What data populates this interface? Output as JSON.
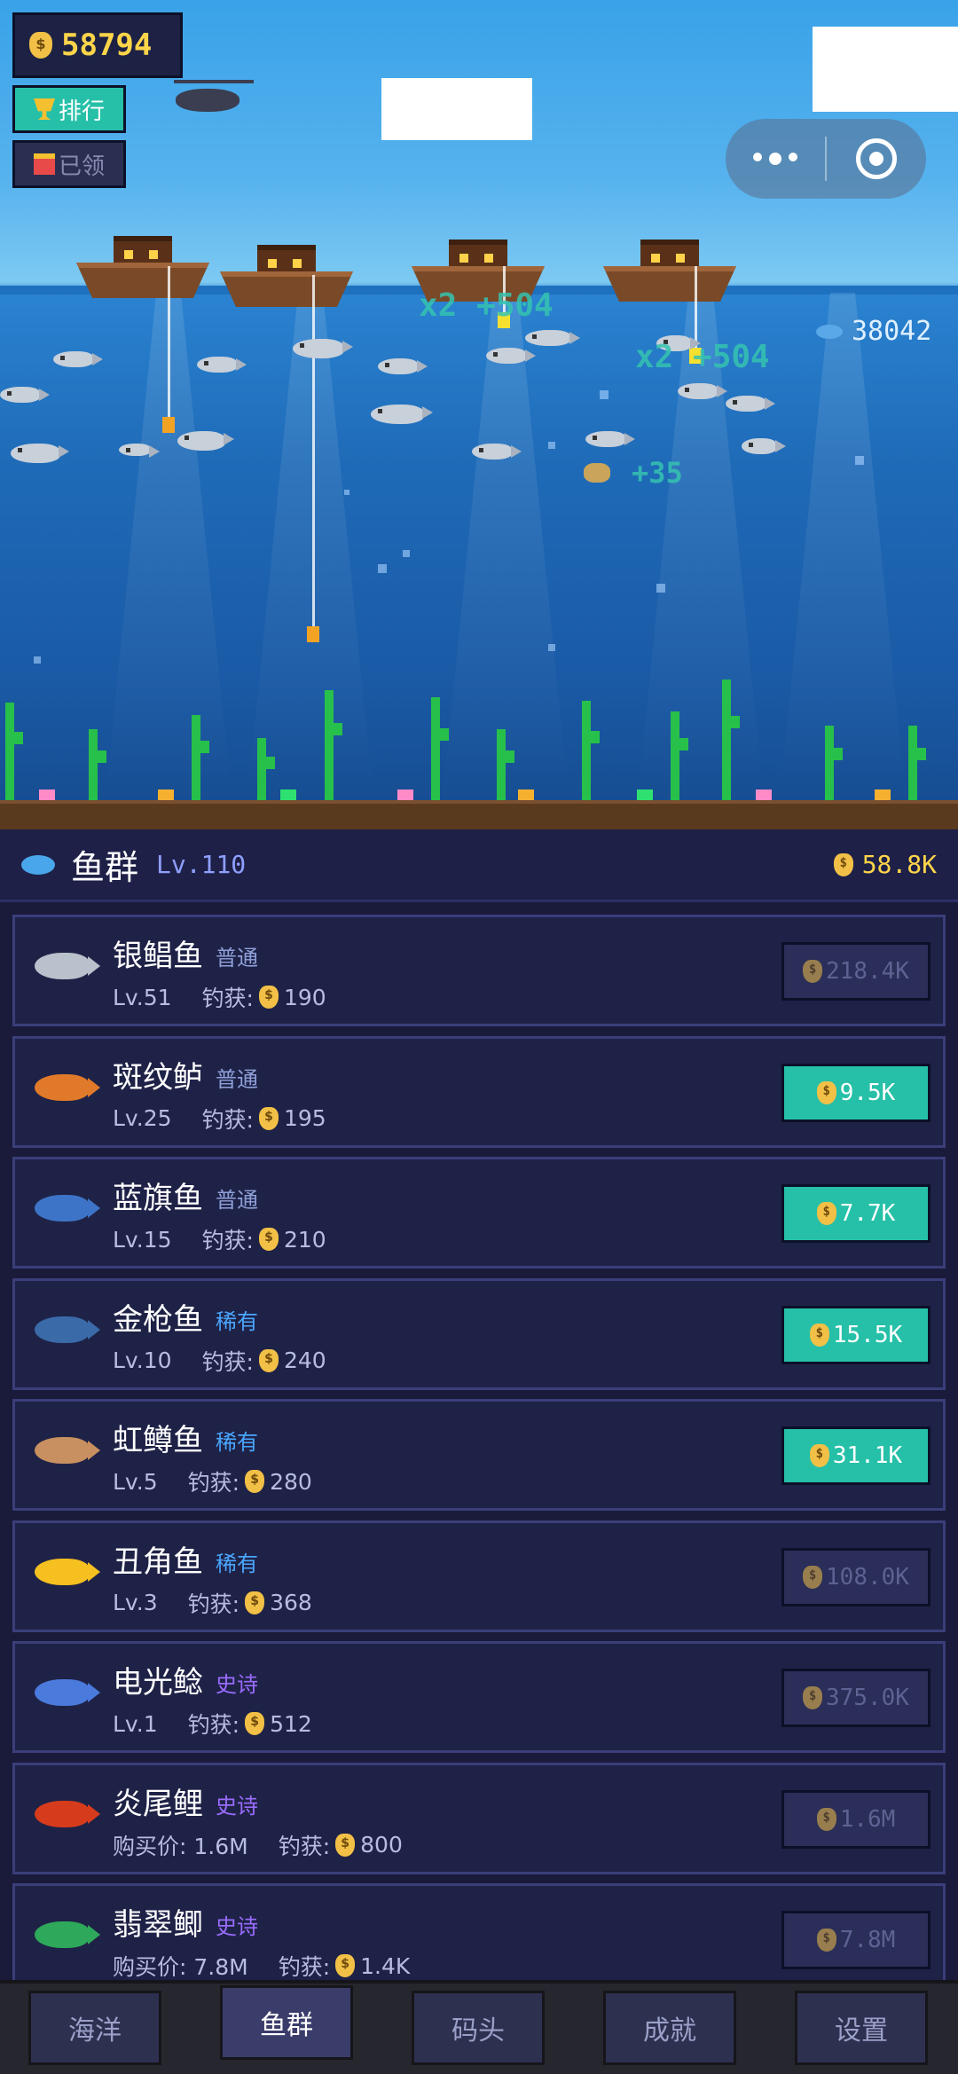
{
  "hud": {
    "money": "58794",
    "rank_label": "排行",
    "gift_label": "已领",
    "fish_count": "38042"
  },
  "scene": {
    "float_texts": [
      "x2 +504",
      "x2 +504",
      "+35"
    ]
  },
  "panel": {
    "title": "鱼群",
    "level": "Lv.110",
    "total": "58.8K"
  },
  "rows": [
    {
      "name": "银鲳鱼",
      "tag": "普通",
      "tag_color": "#8fa0d8",
      "line1": "Lv.51",
      "catch_label": "钓获:",
      "catch_value": "190",
      "price": "218.4K",
      "enabled": false,
      "color": "#b9c2cc"
    },
    {
      "name": "斑纹鲈",
      "tag": "普通",
      "tag_color": "#8fa0d8",
      "line1": "Lv.25",
      "catch_label": "钓获:",
      "catch_value": "195",
      "price": "9.5K",
      "enabled": true,
      "color": "#e07a2a"
    },
    {
      "name": "蓝旗鱼",
      "tag": "普通",
      "tag_color": "#8fa0d8",
      "line1": "Lv.15",
      "catch_label": "钓获:",
      "catch_value": "210",
      "price": "7.7K",
      "enabled": true,
      "color": "#3d74c8"
    },
    {
      "name": "金枪鱼",
      "tag": "稀有",
      "tag_color": "#4aa6ff",
      "line1": "Lv.10",
      "catch_label": "钓获:",
      "catch_value": "240",
      "price": "15.5K",
      "enabled": true,
      "color": "#3a6aa8"
    },
    {
      "name": "虹鳟鱼",
      "tag": "稀有",
      "tag_color": "#4aa6ff",
      "line1": "Lv.5",
      "catch_label": "钓获:",
      "catch_value": "280",
      "price": "31.1K",
      "enabled": true,
      "color": "#c89060"
    },
    {
      "name": "丑角鱼",
      "tag": "稀有",
      "tag_color": "#4aa6ff",
      "line1": "Lv.3",
      "catch_label": "钓获:",
      "catch_value": "368",
      "price": "108.0K",
      "enabled": false,
      "color": "#f5c020"
    },
    {
      "name": "电光鲶",
      "tag": "史诗",
      "tag_color": "#9a6cff",
      "line1": "Lv.1",
      "catch_label": "钓获:",
      "catch_value": "512",
      "price": "375.0K",
      "enabled": false,
      "color": "#4a7adc"
    },
    {
      "name": "炎尾鲤",
      "tag": "史诗",
      "tag_color": "#9a6cff",
      "line1": "购买价: 1.6M",
      "catch_label": "钓获:",
      "catch_value": "800",
      "price": "1.6M",
      "enabled": false,
      "color": "#d63c1c"
    },
    {
      "name": "翡翠鲫",
      "tag": "史诗",
      "tag_color": "#9a6cff",
      "line1": "购买价: 7.8M",
      "catch_label": "钓获:",
      "catch_value": "1.4K",
      "price": "7.8M",
      "enabled": false,
      "color": "#2ea85a"
    }
  ],
  "tabs": [
    {
      "label": "海洋",
      "active": false
    },
    {
      "label": "鱼群",
      "active": true
    },
    {
      "label": "码头",
      "active": false
    },
    {
      "label": "成就",
      "active": false
    },
    {
      "label": "设置",
      "active": false
    }
  ]
}
